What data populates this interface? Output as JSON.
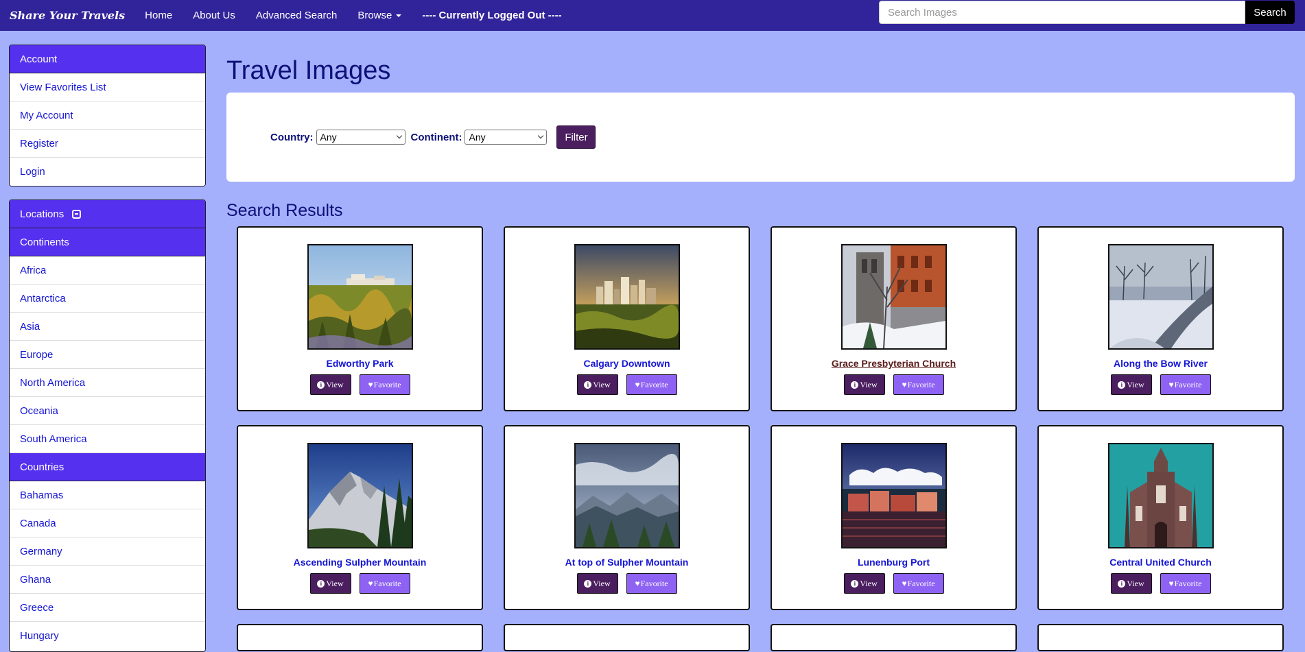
{
  "navbar": {
    "brand": "Share Your Travels",
    "links": [
      "Home",
      "About Us",
      "Advanced Search",
      "Browse"
    ],
    "login_status": "---- Currently Logged Out ----",
    "search_placeholder": "Search Images",
    "search_button": "Search"
  },
  "account_panel": {
    "header": "Account",
    "items": [
      "View Favorites List",
      "My Account",
      "Register",
      "Login"
    ]
  },
  "locations_panel": {
    "header": "Locations",
    "continents_header": "Continents",
    "continents": [
      "Africa",
      "Antarctica",
      "Asia",
      "Europe",
      "North America",
      "Oceania",
      "South America"
    ],
    "countries_header": "Countries",
    "countries": [
      "Bahamas",
      "Canada",
      "Germany",
      "Ghana",
      "Greece",
      "Hungary"
    ]
  },
  "main": {
    "title": "Travel Images",
    "filter": {
      "country_label": "Country:",
      "country_value": "Any",
      "continent_label": "Continent:",
      "continent_value": "Any",
      "button": "Filter"
    },
    "results_title": "Search Results",
    "view_label": "View",
    "favorite_label": "Favorite",
    "results": [
      {
        "title": "Edworthy Park",
        "scene": "park"
      },
      {
        "title": "Calgary Downtown",
        "scene": "skyline"
      },
      {
        "title": "Grace Presbyterian Church",
        "scene": "church-snow"
      },
      {
        "title": "Along the Bow River",
        "scene": "river-path"
      },
      {
        "title": "Ascending Sulpher Mountain",
        "scene": "mountain"
      },
      {
        "title": "At top of Sulpher Mountain",
        "scene": "valley"
      },
      {
        "title": "Lunenburg Port",
        "scene": "port"
      },
      {
        "title": "Central United Church",
        "scene": "church-teal"
      }
    ]
  },
  "colors": {
    "navbar": "#31249a",
    "background": "#a4b0fc",
    "panel_header": "#5530ee",
    "link": "#1414d4",
    "heading": "#0c1077",
    "view_button": "#4b1e60",
    "favorite_button": "#8e62f2"
  }
}
